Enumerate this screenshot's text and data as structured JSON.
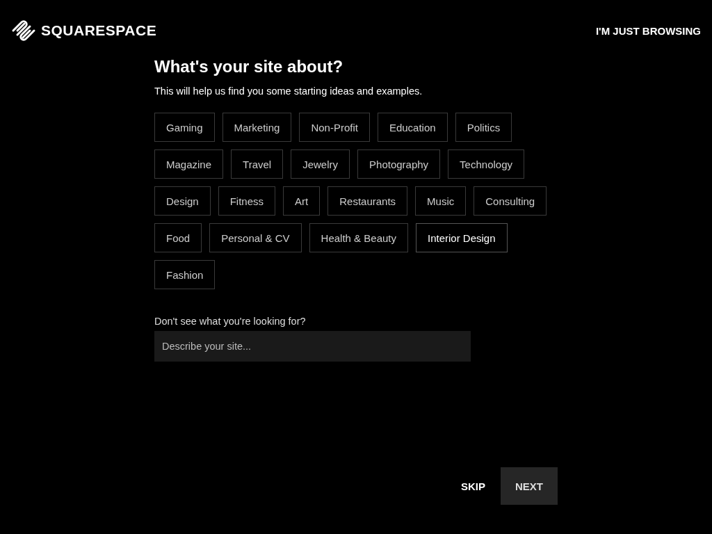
{
  "header": {
    "logo_text": "SQUARESPACE",
    "browse_link": "I'M JUST BROWSING"
  },
  "heading": "What's your site about?",
  "subheading": "This will help us find you some starting ideas and examples.",
  "topics": [
    {
      "label": "Gaming",
      "selected": false
    },
    {
      "label": "Marketing",
      "selected": false
    },
    {
      "label": "Non-Profit",
      "selected": false
    },
    {
      "label": "Education",
      "selected": false
    },
    {
      "label": "Politics",
      "selected": false
    },
    {
      "label": "Magazine",
      "selected": false
    },
    {
      "label": "Travel",
      "selected": false
    },
    {
      "label": "Jewelry",
      "selected": false
    },
    {
      "label": "Photography",
      "selected": false
    },
    {
      "label": "Technology",
      "selected": false
    },
    {
      "label": "Design",
      "selected": false
    },
    {
      "label": "Fitness",
      "selected": false
    },
    {
      "label": "Art",
      "selected": false
    },
    {
      "label": "Restaurants",
      "selected": false
    },
    {
      "label": "Music",
      "selected": false
    },
    {
      "label": "Consulting",
      "selected": false
    },
    {
      "label": "Food",
      "selected": false
    },
    {
      "label": "Personal & CV",
      "selected": false
    },
    {
      "label": "Health & Beauty",
      "selected": false
    },
    {
      "label": "Interior Design",
      "selected": true
    },
    {
      "label": "Fashion",
      "selected": false
    }
  ],
  "custom": {
    "label": "Don't see what you're looking for?",
    "placeholder": "Describe your site..."
  },
  "buttons": {
    "skip": "SKIP",
    "next": "NEXT"
  }
}
